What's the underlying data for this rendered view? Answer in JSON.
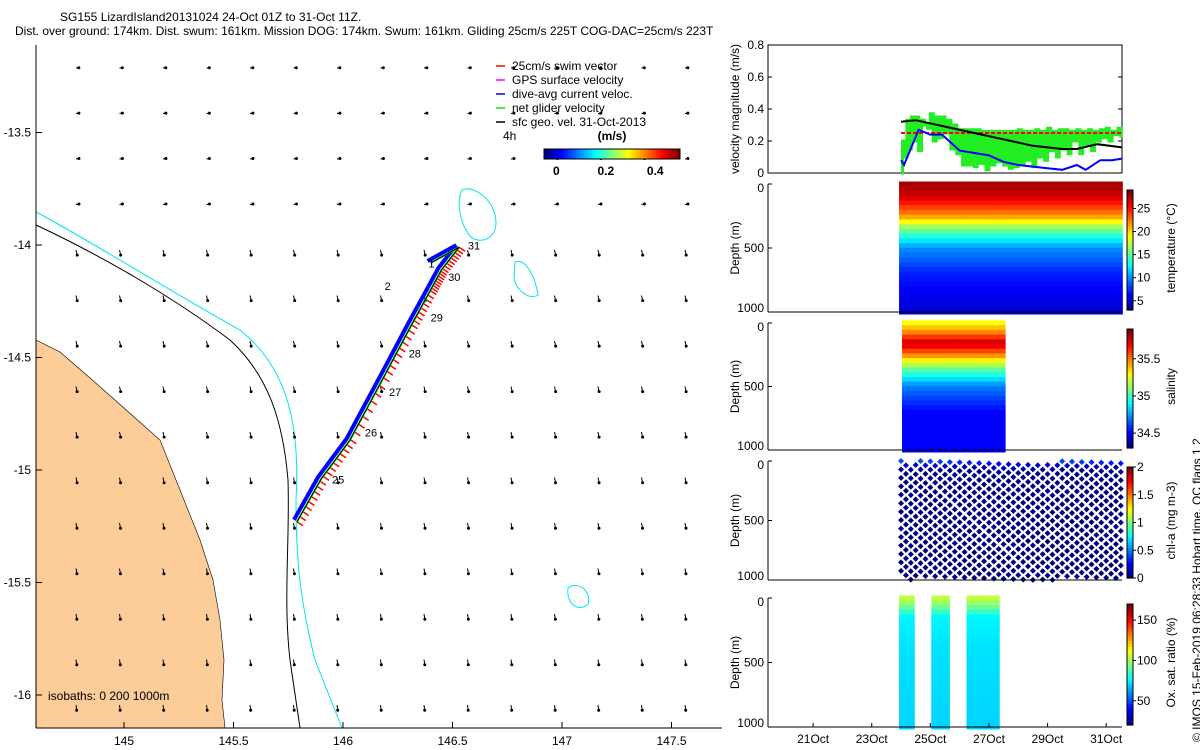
{
  "title_line1": "SG155 LizardIsland20131024 24-Oct 01Z to 31-Oct 11Z.",
  "title_line2": "Dist. over ground: 174km. Dist. swum: 161km. Mission DOG: 174km. Swum: 161km. Gliding 25cm/s 225T COG-DAC=25cm/s 223T",
  "copyright": "© IMOS 15-Feb-2019 06:28:33 Hobart time. QC flags 1  2",
  "chart_data": [
    {
      "type": "map",
      "xlim": [
        144.6,
        147.75
      ],
      "ylim": [
        -16.15,
        -13.2
      ],
      "xticks": [
        "145",
        "145.5",
        "146",
        "146.5",
        "147",
        "147.5"
      ],
      "xtick_values": [
        145,
        145.5,
        146,
        146.5,
        147,
        147.5
      ],
      "yticks": [
        "-13.5",
        "-14",
        "-14.5",
        "-15",
        "-15.5",
        "-16"
      ],
      "ytick_values": [
        -13.5,
        -14,
        -14.5,
        -15,
        -15.5,
        -16
      ],
      "legend": [
        {
          "label": "25cm/s swim vector",
          "color": "#ff0000"
        },
        {
          "label": "GPS surface velocity",
          "color": "#ff00ff"
        },
        {
          "label": "dive-avg current veloc.",
          "color": "#0000ff"
        },
        {
          "label": "net glider velocity",
          "color": "#00ee00"
        },
        {
          "label": "sfc geo. vel. 31-Oct-2013",
          "color": "#000000"
        }
      ],
      "time_step_label": "4h",
      "colorbar": {
        "label": "(m/s)",
        "ticks": [
          "0",
          "0.2",
          "0.4"
        ],
        "tick_values": [
          0,
          0.2,
          0.4
        ],
        "range": [
          -0.05,
          0.5
        ]
      },
      "isobath_label": "isobaths: 0   200  1000m",
      "track": [
        [
          145.79,
          -15.23
        ],
        [
          145.9,
          -15.04
        ],
        [
          146.03,
          -14.87
        ],
        [
          146.19,
          -14.58
        ],
        [
          146.31,
          -14.36
        ],
        [
          146.4,
          -14.2
        ],
        [
          146.45,
          -14.11
        ],
        [
          146.53,
          -14.01
        ],
        [
          146.4,
          -14.08
        ]
      ],
      "day_labels": [
        {
          "text": "25",
          "lon": 145.95,
          "lat": -15.06
        },
        {
          "text": "26",
          "lon": 146.1,
          "lat": -14.85
        },
        {
          "text": "27",
          "lon": 146.21,
          "lat": -14.67
        },
        {
          "text": "28",
          "lon": 146.3,
          "lat": -14.5
        },
        {
          "text": "29",
          "lon": 146.4,
          "lat": -14.34
        },
        {
          "text": "30",
          "lon": 146.48,
          "lat": -14.16
        },
        {
          "text": "31",
          "lon": 146.57,
          "lat": -14.02
        },
        {
          "text": "1",
          "lon": 146.39,
          "lat": -14.1
        },
        {
          "text": "2",
          "lon": 146.19,
          "lat": -14.2
        }
      ]
    },
    {
      "type": "line",
      "ylabel": "velocity magnitude (m/s)",
      "ylim": [
        0,
        0.8
      ],
      "yticks": [
        "0",
        "0.2",
        "0.4",
        "0.6",
        "0.8"
      ],
      "ytick_values": [
        0,
        0.2,
        0.4,
        0.6,
        0.8
      ],
      "xlim_day": [
        19.46,
        31.54
      ],
      "series": [
        {
          "name": "net glider velocity",
          "color": "#22ee22",
          "x": [
            24.0,
            24.05,
            24.1,
            24.2,
            24.3,
            24.35,
            24.4,
            24.5,
            24.6,
            24.7,
            24.8,
            24.9,
            25.0,
            25.1,
            25.2,
            25.3,
            25.4,
            25.5,
            25.6,
            25.7,
            25.8,
            25.9,
            26.0,
            26.1,
            26.2,
            26.3,
            26.4,
            26.5,
            26.6,
            26.7,
            26.8,
            26.9,
            27.0,
            27.1,
            27.2,
            27.3,
            27.4,
            27.5,
            27.6,
            27.7,
            27.8,
            27.9,
            28.0,
            28.1,
            28.2,
            28.3,
            28.4,
            28.5,
            28.6,
            28.7,
            28.8,
            28.9,
            29.0,
            29.1,
            29.2,
            29.3,
            29.4,
            29.5,
            29.6,
            29.7,
            29.8,
            29.9,
            30.0,
            30.1,
            30.2,
            30.3,
            30.4,
            30.5,
            30.6,
            30.7,
            30.8,
            30.9,
            31.0,
            31.1,
            31.2,
            31.3,
            31.4,
            31.5
          ],
          "y": [
            0.0,
            0.2,
            0.1,
            0.33,
            0.15,
            0.35,
            0.2,
            0.35,
            0.14,
            0.33,
            0.3,
            0.28,
            0.37,
            0.2,
            0.35,
            0.22,
            0.35,
            0.25,
            0.33,
            0.15,
            0.3,
            0.12,
            0.27,
            0.05,
            0.27,
            0.05,
            0.27,
            0.04,
            0.27,
            0.06,
            0.26,
            0.02,
            0.26,
            0.05,
            0.26,
            0.07,
            0.26,
            0.05,
            0.26,
            0.03,
            0.26,
            0.04,
            0.27,
            0.06,
            0.26,
            0.08,
            0.26,
            0.04,
            0.27,
            0.1,
            0.26,
            0.08,
            0.28,
            0.14,
            0.26,
            0.1,
            0.27,
            0.15,
            0.27,
            0.12,
            0.26,
            0.2,
            0.27,
            0.12,
            0.26,
            0.18,
            0.27,
            0.14,
            0.26,
            0.2,
            0.27,
            0.22,
            0.28,
            0.2,
            0.26,
            0.24,
            0.28,
            0.22
          ]
        },
        {
          "name": "25cm/s swim vector",
          "color": "#ff0000",
          "x": [
            24.0,
            31.54
          ],
          "y": [
            0.25,
            0.25
          ]
        },
        {
          "name": "surface geostrophic",
          "color": "#000000",
          "x": [
            24.0,
            24.5,
            25.5,
            26.5,
            27.5,
            28.5,
            29.5,
            30.0,
            30.7,
            31.54
          ],
          "y": [
            0.32,
            0.33,
            0.29,
            0.25,
            0.21,
            0.17,
            0.15,
            0.15,
            0.18,
            0.16
          ]
        },
        {
          "name": "dive-avg current veloc.",
          "color": "#0000ff",
          "x": [
            24.0,
            24.1,
            24.6,
            25.0,
            25.4,
            26.0,
            27.0,
            27.5,
            28.0,
            29.0,
            29.5,
            30.0,
            30.3,
            30.8,
            31.2,
            31.54
          ],
          "y": [
            0.08,
            0.05,
            0.27,
            0.24,
            0.24,
            0.14,
            0.11,
            0.07,
            0.05,
            0.03,
            0.02,
            0.05,
            0.02,
            0.08,
            0.08,
            0.09
          ]
        }
      ]
    },
    {
      "type": "scatter",
      "variable": "temperature",
      "ylabel": "Depth (m)",
      "clabel": "temperature (°C)",
      "ylim": [
        0,
        1000
      ],
      "yticks": [
        "0",
        "500",
        "1000"
      ],
      "ytick_values": [
        0,
        500,
        1000
      ],
      "crange": [
        3,
        29
      ],
      "cticks": [
        "5",
        "10",
        "15",
        "20",
        "25"
      ],
      "ctick_values": [
        5,
        10,
        15,
        20,
        25
      ],
      "day_range": [
        24.0,
        31.5
      ],
      "max_depth": 1000,
      "profile": [
        [
          0,
          28
        ],
        [
          100,
          27
        ],
        [
          250,
          22
        ],
        [
          350,
          16
        ],
        [
          500,
          10
        ],
        [
          700,
          7
        ],
        [
          1000,
          5
        ]
      ]
    },
    {
      "type": "scatter",
      "variable": "salinity",
      "ylabel": "Depth (m)",
      "clabel": "salinity",
      "ylim": [
        0,
        1000
      ],
      "yticks": [
        "0",
        "500",
        "1000"
      ],
      "ytick_values": [
        0,
        500,
        1000
      ],
      "crange": [
        34.3,
        35.9
      ],
      "cticks": [
        "34.5",
        "35",
        "35.5"
      ],
      "ctick_values": [
        34.5,
        35,
        35.5
      ],
      "day_range": [
        24.1,
        27.5
      ],
      "max_depth": 1000,
      "profile": [
        [
          0,
          35.3
        ],
        [
          80,
          35.5
        ],
        [
          160,
          35.8
        ],
        [
          250,
          35.5
        ],
        [
          350,
          35.1
        ],
        [
          500,
          34.7
        ],
        [
          700,
          34.5
        ],
        [
          1000,
          34.5
        ]
      ]
    },
    {
      "type": "scatter",
      "variable": "chl-a",
      "ylabel": "Depth (m)",
      "clabel": "chl-a (mg m-3)",
      "ylim": [
        0,
        1000
      ],
      "yticks": [
        "0",
        "500",
        "1000"
      ],
      "ytick_values": [
        0,
        500,
        1000
      ],
      "crange": [
        0,
        2
      ],
      "cticks": [
        "0",
        "0.5",
        "1",
        "1.5",
        "2"
      ],
      "ctick_values": [
        0,
        0.5,
        1,
        1.5,
        2
      ],
      "day_range": [
        24.0,
        31.5
      ],
      "max_depth": 1000,
      "profile": [
        [
          0,
          0.4
        ],
        [
          50,
          0.1
        ],
        [
          100,
          0.02
        ],
        [
          1000,
          0.0
        ]
      ]
    },
    {
      "type": "scatter",
      "variable": "oxygen",
      "ylabel": "Depth (m)",
      "clabel": "Ox. sat. ratio (%)",
      "ylim": [
        0,
        1000
      ],
      "yticks": [
        "0",
        "500",
        "1000"
      ],
      "ytick_values": [
        0,
        500,
        1000
      ],
      "crange": [
        20,
        170
      ],
      "cticks": [
        "50",
        "100",
        "150"
      ],
      "ctick_values": [
        50,
        100,
        150
      ],
      "segments": [
        [
          24.0,
          24.4
        ],
        [
          25.1,
          25.6
        ],
        [
          26.3,
          27.3
        ]
      ],
      "max_depth": 1000,
      "profile": [
        [
          0,
          105
        ],
        [
          60,
          95
        ],
        [
          150,
          75
        ],
        [
          400,
          72
        ],
        [
          1000,
          70
        ]
      ],
      "xticks": [
        "21Oct",
        "23Oct",
        "25Oct",
        "27Oct",
        "29Oct",
        "31Oct"
      ],
      "xtick_days": [
        21,
        23,
        25,
        27,
        29,
        31
      ]
    }
  ]
}
